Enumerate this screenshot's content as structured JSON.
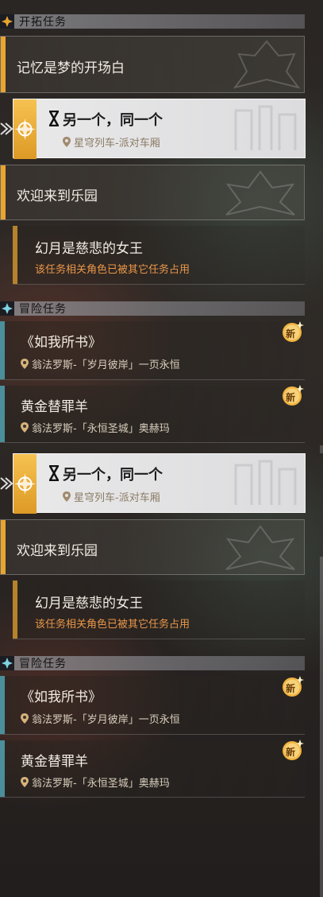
{
  "section_main": {
    "title": "开拓任务"
  },
  "section_adventure": {
    "title": "冒险任务"
  },
  "quests": {
    "memory": {
      "name": "记忆是梦的开场白"
    },
    "selected": {
      "name": "另一个，同一个",
      "location": "星穹列车-派对车厢"
    },
    "welcome": {
      "name": "欢迎来到乐园"
    },
    "phantom": {
      "name": "幻月是慈悲的女王",
      "warning": "该任务相关角色已被其它任务占用"
    },
    "book": {
      "name": "《如我所书》",
      "location": "翁法罗斯-「岁月彼岸」一页永恒"
    },
    "sheep": {
      "name": "黄金替罪羊",
      "location": "翁法罗斯-「永恒圣城」奥赫玛"
    }
  },
  "new_badge": {
    "label": "新"
  },
  "colors": {
    "main_accent": "#e8a52f",
    "adventure_accent": "#4a8f9a",
    "warning": "#e9974a"
  },
  "icons": [
    "diamond-icon",
    "hourglass-icon",
    "location-pin-icon",
    "arrow-pointer-icon",
    "new-badge-icon"
  ]
}
